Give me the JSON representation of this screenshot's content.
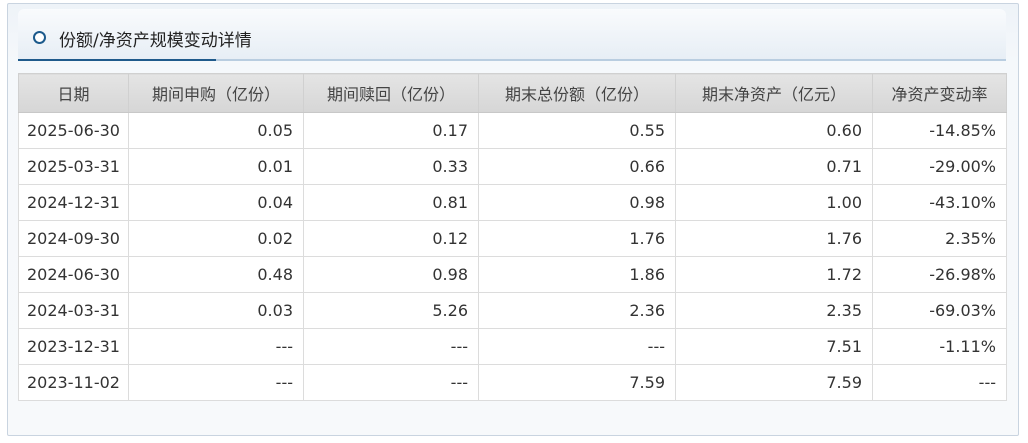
{
  "panel": {
    "title": "份额/净资产规模变动详情"
  },
  "table": {
    "headers": [
      "日期",
      "期间申购（亿份）",
      "期间赎回（亿份）",
      "期末总份额（亿份）",
      "期末净资产（亿元）",
      "净资产变动率"
    ],
    "rows": [
      [
        "2025-06-30",
        "0.05",
        "0.17",
        "0.55",
        "0.60",
        "-14.85%"
      ],
      [
        "2025-03-31",
        "0.01",
        "0.33",
        "0.66",
        "0.71",
        "-29.00%"
      ],
      [
        "2024-12-31",
        "0.04",
        "0.81",
        "0.98",
        "1.00",
        "-43.10%"
      ],
      [
        "2024-09-30",
        "0.02",
        "0.12",
        "1.76",
        "1.76",
        "2.35%"
      ],
      [
        "2024-06-30",
        "0.48",
        "0.98",
        "1.86",
        "1.72",
        "-26.98%"
      ],
      [
        "2024-03-31",
        "0.03",
        "5.26",
        "2.36",
        "2.35",
        "-69.03%"
      ],
      [
        "2023-12-31",
        "---",
        "---",
        "---",
        "7.51",
        "-1.11%"
      ],
      [
        "2023-11-02",
        "---",
        "---",
        "7.59",
        "7.59",
        "---"
      ]
    ]
  },
  "colors": {
    "accent": "#1f5a8b",
    "header_bg": "#d9d9d9",
    "border": "#dcdcdc"
  }
}
